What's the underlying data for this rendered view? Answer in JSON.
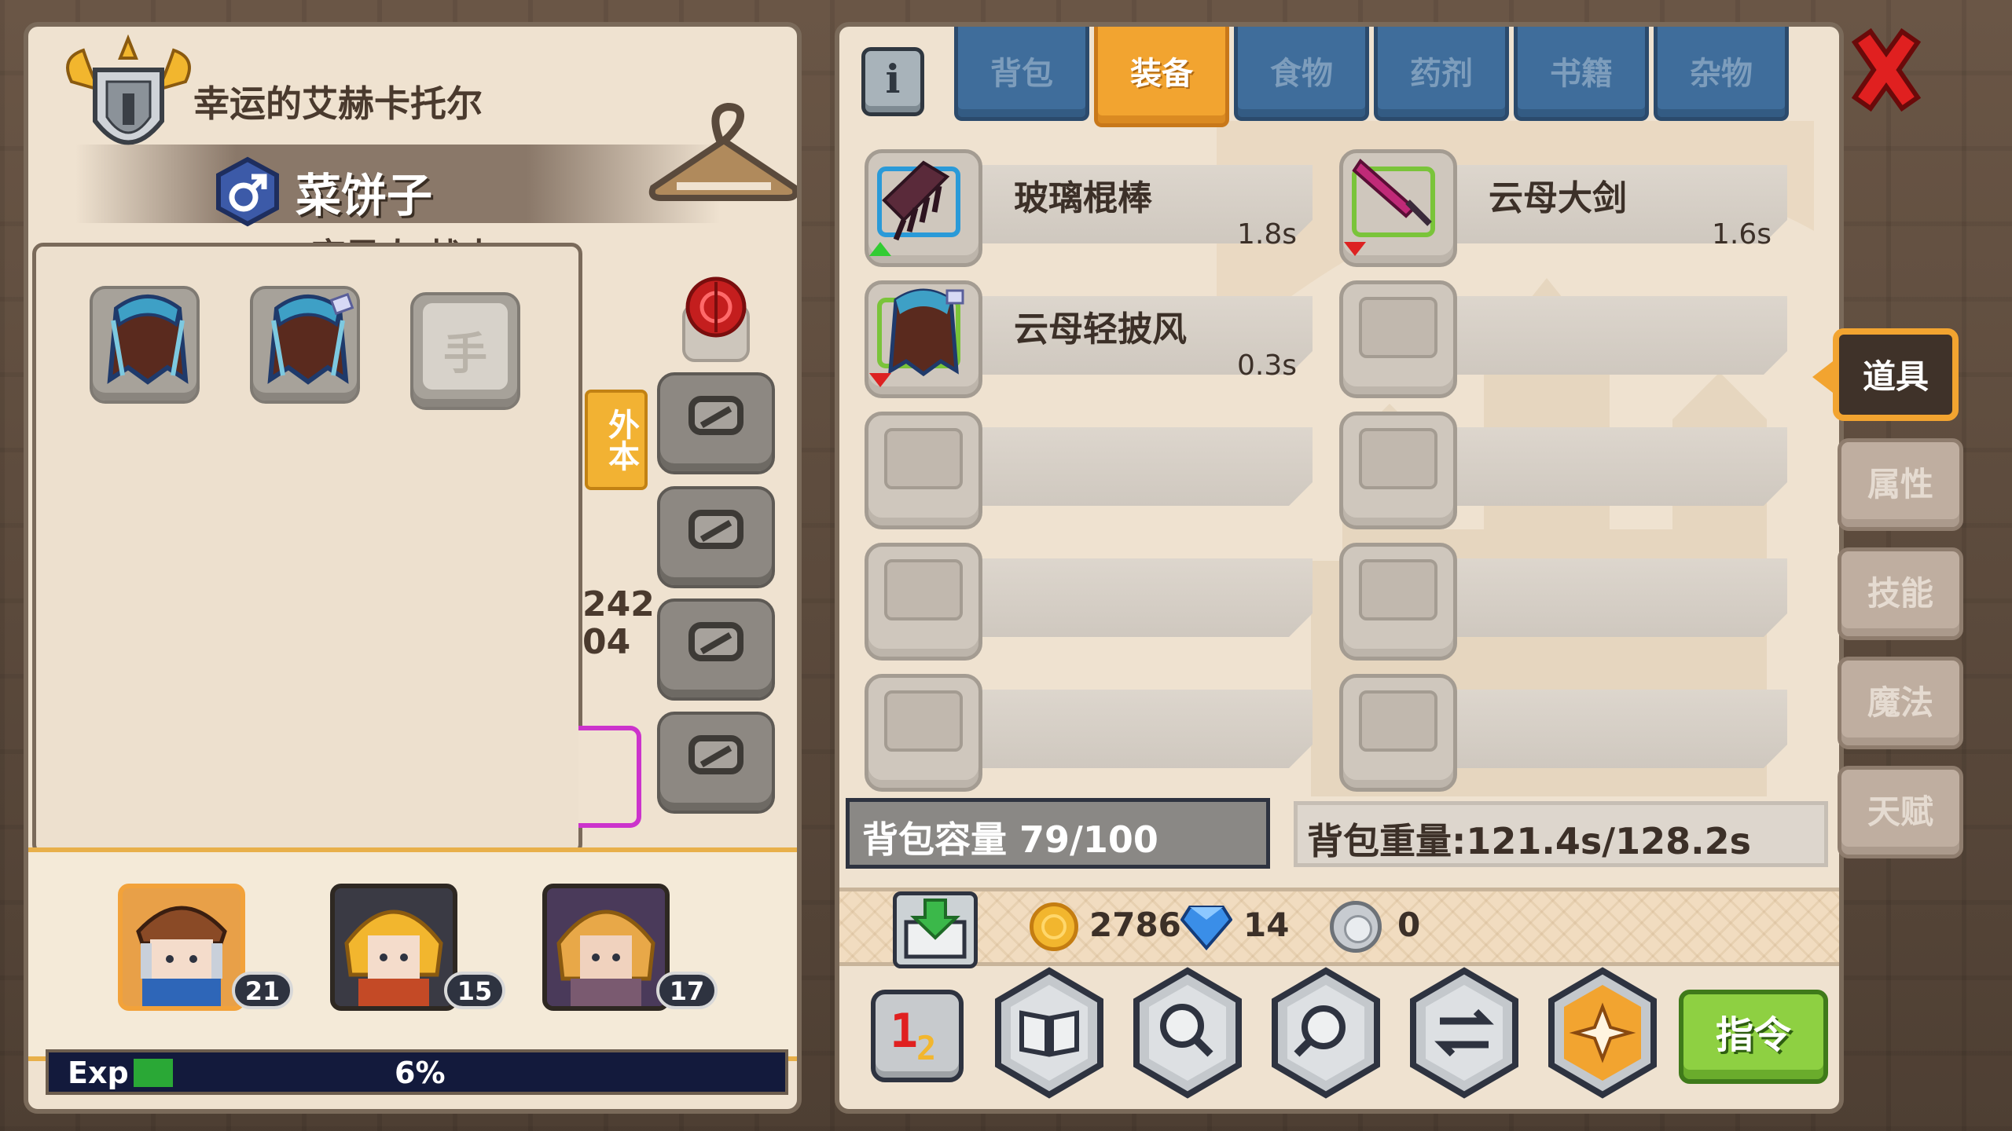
{
  "character": {
    "title": "幸运的艾赫卡托尔",
    "name": "菜饼子",
    "gender_symbol": "♂",
    "class_text": "变异人 战士",
    "slot_label": "手",
    "side_tag": "外本",
    "peek_numbers": [
      "242",
      "04"
    ]
  },
  "party": [
    {
      "level": "21",
      "active": true
    },
    {
      "level": "15",
      "active": false
    },
    {
      "level": "17",
      "active": false
    }
  ],
  "exp": {
    "label": "Exp",
    "percent_text": "6%",
    "percent": 6
  },
  "inventory": {
    "info_icon": "i",
    "tabs": [
      {
        "label": "背包",
        "active": false
      },
      {
        "label": "装备",
        "active": true
      },
      {
        "label": "食物",
        "active": false
      },
      {
        "label": "药剂",
        "active": false
      },
      {
        "label": "书籍",
        "active": false
      },
      {
        "label": "杂物",
        "active": false
      }
    ],
    "items": [
      {
        "name": "玻璃棍棒",
        "weight": "1.8s",
        "icon": "comb-icon",
        "indicator": "up"
      },
      {
        "name": "云母大剑",
        "weight": "1.6s",
        "icon": "greatsword-icon",
        "indicator": "down"
      },
      {
        "name": "云母轻披风",
        "weight": "0.3s",
        "icon": "cape-icon",
        "indicator": "down"
      }
    ],
    "capacity": "背包容量 79/100",
    "weight": "背包重量:121.4s/128.2s"
  },
  "currency": {
    "gold": "2786",
    "gems": "14",
    "silver": "0"
  },
  "actions": {
    "sort_label_1": "1",
    "sort_label_2": "2",
    "command_label": "指令",
    "icons": [
      "book-icon",
      "magnify-icon",
      "search-icon",
      "swap-icon",
      "shuriken-icon"
    ]
  },
  "side_tabs": [
    {
      "label": "道具",
      "active": true
    },
    {
      "label": "属性",
      "active": false
    },
    {
      "label": "技能",
      "active": false
    },
    {
      "label": "魔法",
      "active": false
    },
    {
      "label": "天赋",
      "active": false
    }
  ],
  "colors": {
    "accent": "#f2a430",
    "tab_blue": "#3f6d9b",
    "command_green": "#8ed042",
    "close_red": "#e02020"
  }
}
